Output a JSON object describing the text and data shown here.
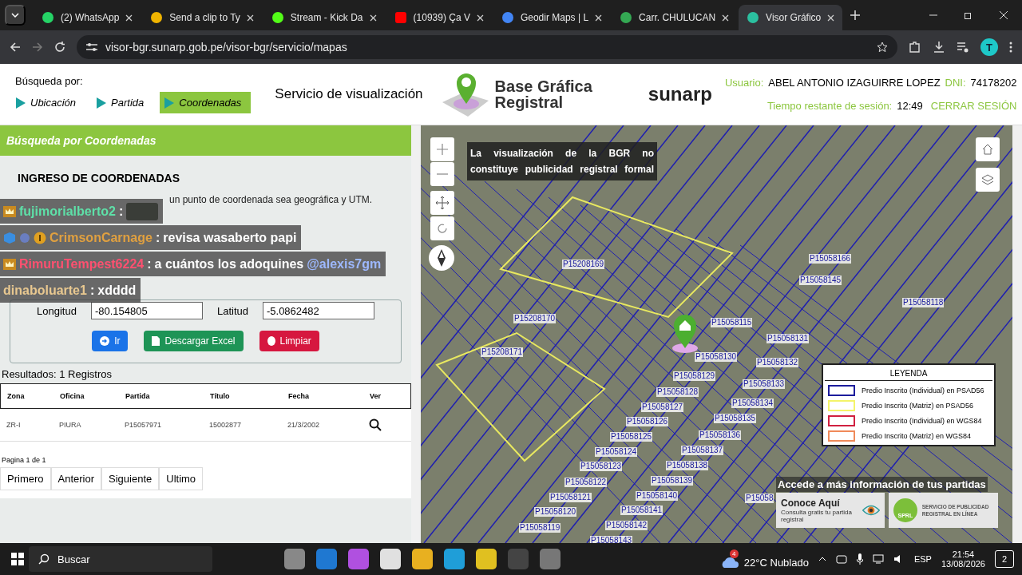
{
  "browser": {
    "tabs": [
      {
        "title": "(2) WhatsApp",
        "selected": false
      },
      {
        "title": "Send a clip to Ty",
        "selected": false
      },
      {
        "title": "Stream - Kick Da",
        "selected": false
      },
      {
        "title": "(10939) Ça V",
        "selected": false
      },
      {
        "title": "Geodir Maps | L",
        "selected": false
      },
      {
        "title": "Carr. CHULUCAN",
        "selected": false
      },
      {
        "title": "Visor Gráfico",
        "selected": true
      }
    ],
    "address": "visor-bgr.sunarp.gob.pe/visor-bgr/servicio/mapas",
    "profile_initial": "T"
  },
  "header": {
    "search_by_label": "Búsqueda por:",
    "search_by": [
      {
        "label": "Ubicación",
        "selected": false
      },
      {
        "label": "Partida",
        "selected": false
      },
      {
        "label": "Coordenadas",
        "selected": true
      }
    ],
    "service_title": "Servicio de visualización",
    "logo_lines": [
      "Base Gráfica",
      "Registral"
    ],
    "sunarp_logo": "sunarp",
    "user_label": "Usuario:",
    "user_name": "ABEL ANTONIO IZAGUIRRE LOPEZ",
    "dni_label": "DNI:",
    "dni": "74178202",
    "session_label": "Tiempo restante de sesión:",
    "session_time": "12:49",
    "logout": "CERRAR SESIÓN"
  },
  "search_panel": {
    "title": "Búsqueda por Coordenadas",
    "section_title": "INGRESO DE COORDENADAS",
    "hint": "un punto de coordenada sea geográfica y UTM.",
    "fields": [
      {
        "label": "Longitud",
        "value": "-80.154805"
      },
      {
        "label": "Latitud",
        "value": "-5.0862482"
      }
    ],
    "buttons": [
      {
        "label": "Ir",
        "kind": "go"
      },
      {
        "label": "Descargar Excel",
        "kind": "excel"
      },
      {
        "label": "Limpiar",
        "kind": "clear"
      }
    ]
  },
  "results": {
    "summary": "Resultados: 1 Registros",
    "columns": [
      "Zona",
      "Oficina",
      "Partida",
      "Título",
      "Fecha",
      "Ver"
    ],
    "rows": [
      [
        "ZR-I",
        "PIURA",
        "P15057971",
        "15002877",
        "21/3/2002"
      ]
    ],
    "page_info": "Pagina 1 de 1",
    "pager": [
      "Primero",
      "Anterior",
      "Siguiente",
      "Ultimo"
    ]
  },
  "chat": [
    {
      "user": "fujimorialberto2",
      "color": "#5ee0a8",
      "separator": ":",
      "emote": true
    },
    {
      "user": "CrimsonCarnage",
      "color": "#e0a040",
      "separator": ":",
      "message": "revisa wasaberto papi"
    },
    {
      "user": "RimuruTempest6224",
      "color": "#ff5070",
      "separator": ":",
      "message": "a cuántos los adoquines",
      "mention": "@alexis7gm"
    },
    {
      "user": "dinaboluarte1",
      "color": "#e8c890",
      "separator": ":",
      "message": "xdddd"
    }
  ],
  "map": {
    "notice": "La visualización de la BGR no constituye publicidad registral formal",
    "parcel_labels": [
      "P15208169",
      "P15058166",
      "P15058145",
      "P15058118",
      "P15208170",
      "P15058115",
      "P15058131",
      "P15208171",
      "P15058130",
      "P15058132",
      "P15058129",
      "P15058133",
      "P15058128",
      "P15058134",
      "P15058127",
      "P15058135",
      "P15058126",
      "P15058136",
      "P15058125",
      "P15058124",
      "P15058137",
      "P15058123",
      "P15058138",
      "P15058122",
      "P15058139",
      "P15058121",
      "P15058140",
      "P15058141",
      "P15058120",
      "P15058119",
      "P15058142",
      "P15058143",
      "P15058"
    ],
    "legend": {
      "title": "LEYENDA",
      "items": [
        {
          "label": "Predio Inscrito (Individual) en PSAD56",
          "color": "#1c1c9c"
        },
        {
          "label": "Predio Inscrito (Matriz) en PSAD56",
          "color": "#f4f46a"
        },
        {
          "label": "Predio Inscrito (Individual) en WGS84",
          "color": "#d02040"
        },
        {
          "label": "Predio Inscrito (Matriz) en WGS84",
          "color": "#f08a5a"
        }
      ]
    },
    "promo": {
      "title": "Accede a más información de tus partidas",
      "cards": [
        {
          "kind": "conoce",
          "title": "Conoce Aquí",
          "subtitle": "Consulta gratis tu partida registral"
        },
        {
          "kind": "sprl",
          "title": "SERVICIO DE PUBLICIDAD REGISTRAL EN LÍNEA",
          "badge": "SPRL"
        }
      ]
    }
  },
  "taskbar": {
    "search": "Buscar",
    "weather_badge": "4",
    "weather": "22°C Nublado",
    "language": "ESP",
    "time": "21:54",
    "date": "13/08/2026",
    "notifications": "2"
  }
}
